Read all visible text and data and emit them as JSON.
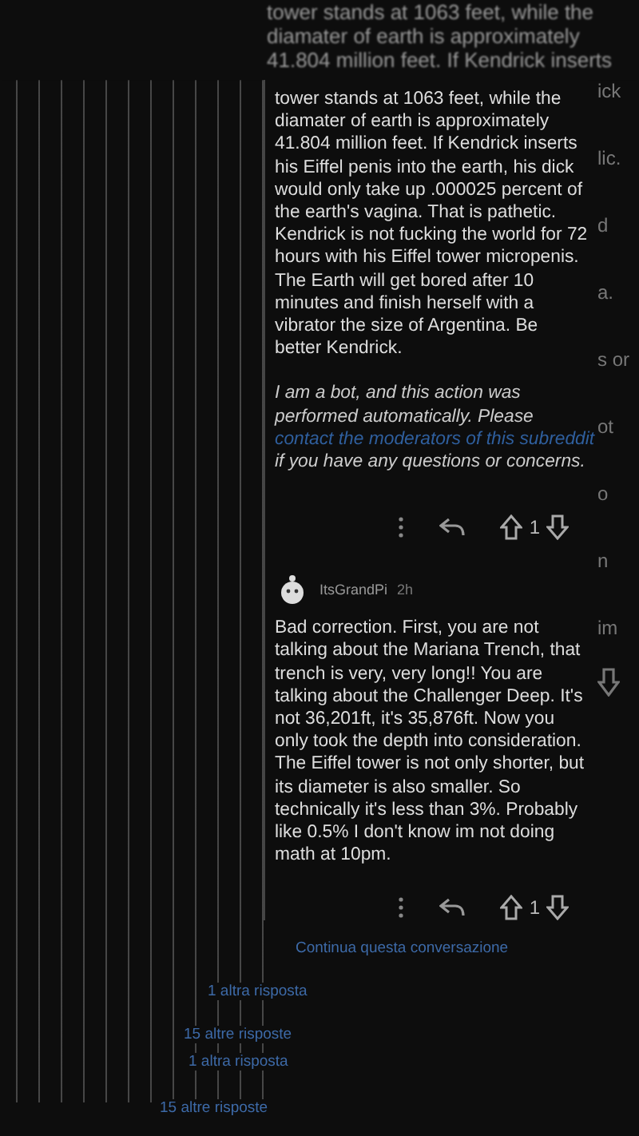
{
  "background_comment": {
    "lines": [
      "tower stands at 1063 feet, while the",
      "diamater of earth is approximately",
      "41.804 million feet. If Kendrick inserts"
    ]
  },
  "edge_fragments": [
    "ick",
    "lic.",
    "d",
    "a.",
    "s or",
    "ot",
    "o",
    "n",
    "im"
  ],
  "bot_comment": {
    "body": "tower stands at 1063 feet, while the diamater of earth is approximately 41.804 million feet. If Kendrick inserts his Eiffel penis into the earth, his dick would only take up .000025 percent of the earth's vagina. That is pathetic. Kendrick is not fucking the world for 72 hours with his Eiffel tower micropenis. The Earth will get bored after 10 minutes and finish herself with a vibrator the size of Argentina. Be better Kendrick.",
    "notice_before": "I am a bot, and this action was performed automatically. Please",
    "notice_link": "contact the moderators of this subreddit",
    "notice_after": "if you have any questions or concerns.",
    "score": "1"
  },
  "reply": {
    "author": "ItsGrandPi",
    "age": "2h",
    "body": "Bad correction. First, you are not talking about the Mariana Trench, that trench is very, very long!! You are talking about the Challenger Deep. It's not 36,201ft, it's 35,876ft. Now you only took the depth into consideration. The Eiffel tower is not only shorter, but its diameter is also smaller. So technically it's less than 3%. Probably like 0.5% I don't know im not doing math at 10pm.",
    "score": "1"
  },
  "thread_links": [
    "Continua questa conversazione",
    "1 altra risposta",
    "15 altre risposte",
    "1 altra risposta",
    "15 altre risposte"
  ]
}
